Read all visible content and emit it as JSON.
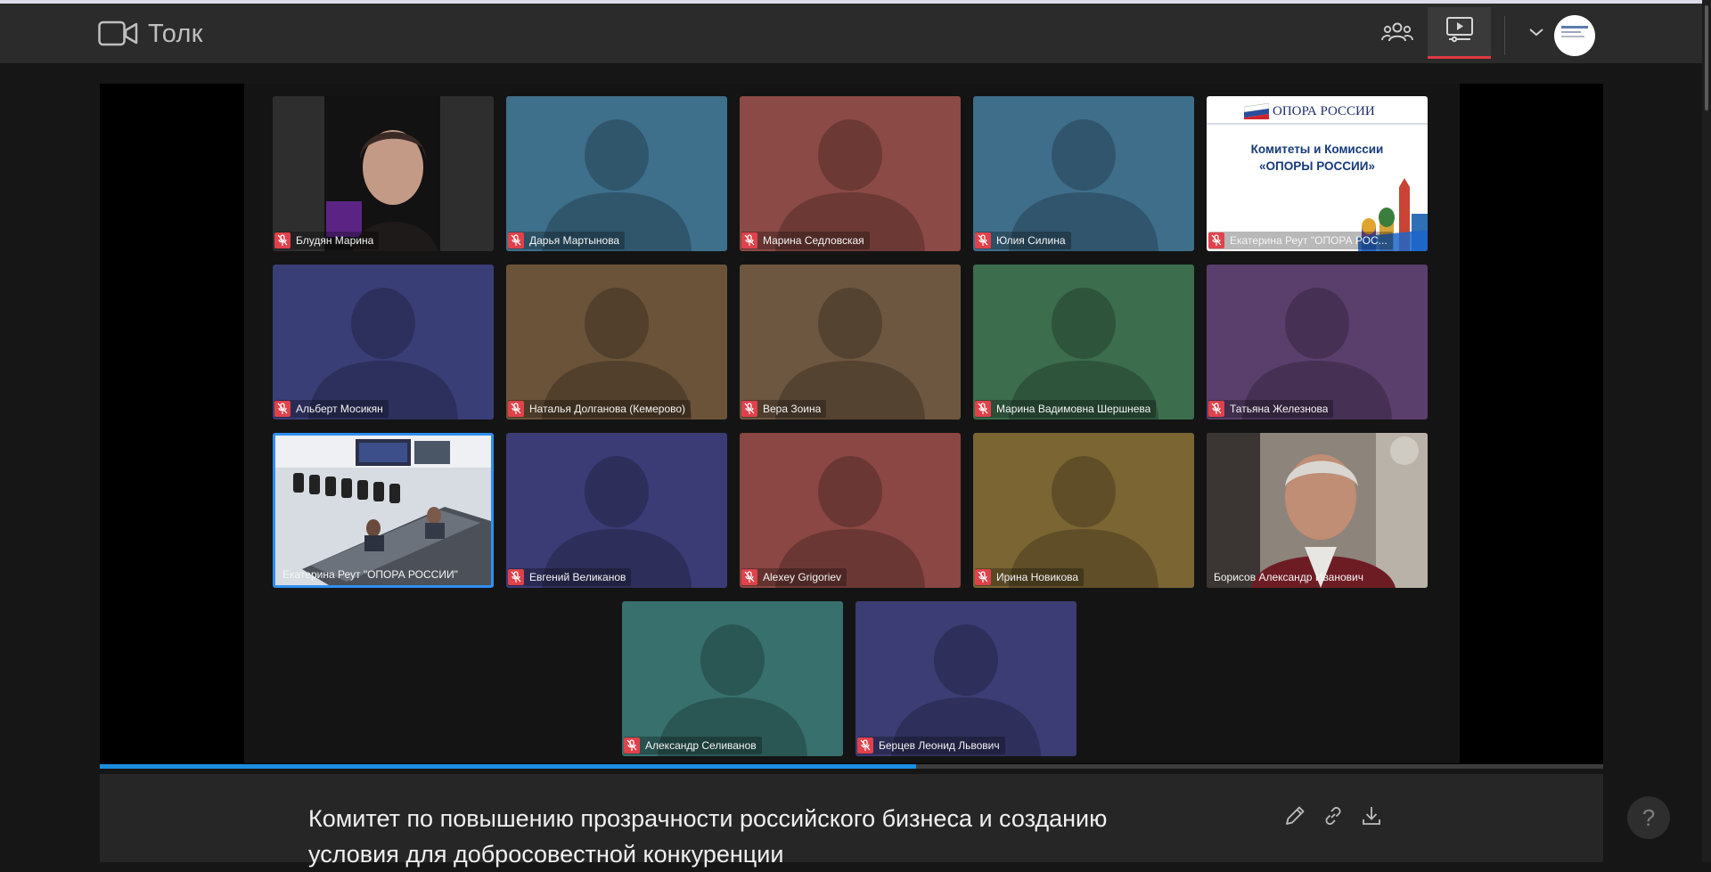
{
  "app": {
    "name": "Толк"
  },
  "toolbar": {
    "icons": [
      "camera-icon",
      "participants-icon",
      "presentation-icon",
      "chevron-down-icon"
    ],
    "accent_color": "#e0393f"
  },
  "video_grid": {
    "tiles": [
      {
        "name": "Блудян Марина",
        "muted": true,
        "kind": "webcam",
        "color": "#3a3a3a"
      },
      {
        "name": "Дарья Мартынова",
        "muted": true,
        "kind": "avatar",
        "color": "#3e6f8b"
      },
      {
        "name": "Марина Седловская",
        "muted": true,
        "kind": "avatar",
        "color": "#8b4a45"
      },
      {
        "name": "Юлия Силина",
        "muted": true,
        "kind": "avatar",
        "color": "#3f6e8b"
      },
      {
        "name": "Екатерина Реут \"ОПОРА РОС...",
        "muted": true,
        "kind": "slide",
        "color": "#ffffff"
      },
      {
        "name": "Альберт Мосикян",
        "muted": true,
        "kind": "avatar",
        "color": "#3a3e76"
      },
      {
        "name": "Наталья Долганова (Кемерово)",
        "muted": true,
        "kind": "avatar",
        "color": "#6b5339"
      },
      {
        "name": "Вера Зоина",
        "muted": true,
        "kind": "avatar",
        "color": "#6e5740"
      },
      {
        "name": "Марина Вадимовна Шершнева",
        "muted": true,
        "kind": "avatar",
        "color": "#3c6d4d"
      },
      {
        "name": "Татьяна Железнова",
        "muted": true,
        "kind": "avatar",
        "color": "#5a3f6c"
      },
      {
        "name": "Екатерина Реут \"ОПОРА РОССИИ\"",
        "muted": false,
        "kind": "room",
        "color": "#cfd3da",
        "active": true
      },
      {
        "name": "Евгений Великанов",
        "muted": true,
        "kind": "avatar",
        "color": "#3b3b75"
      },
      {
        "name": "Alexey Grigoriev",
        "muted": true,
        "kind": "avatar",
        "color": "#8a4743"
      },
      {
        "name": "Ирина Новикова",
        "muted": true,
        "kind": "avatar",
        "color": "#7a6533"
      },
      {
        "name": "Борисов Александр Иванович",
        "muted": false,
        "kind": "webcam2",
        "color": "#8a8078"
      },
      {
        "name": "Александр Селиванов",
        "muted": true,
        "kind": "avatar",
        "color": "#37706c"
      },
      {
        "name": "Берцев Леонид Львович",
        "muted": true,
        "kind": "avatar",
        "color": "#3c3d74"
      }
    ]
  },
  "slide": {
    "brand": "ОПОРА РОССИИ",
    "heading_line1": "Комитеты и Комиссии",
    "heading_line2": "«ОПОРЫ РОССИИ»"
  },
  "playback": {
    "progress_fraction": 0.543,
    "fill_color": "#1c8fe0"
  },
  "meeting": {
    "title": "Комитет по повышению прозрачности российского бизнеса и созданию условия для добросовестной конкуренции"
  },
  "actions": {
    "icons": [
      "pencil-icon",
      "link-icon",
      "download-icon"
    ]
  },
  "help": {
    "label": "?"
  }
}
